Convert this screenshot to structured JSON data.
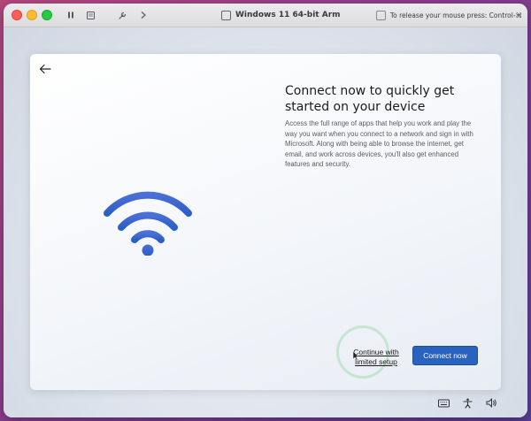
{
  "window": {
    "title": "Windows 11 64-bit Arm",
    "release_hint": "To release your mouse press: Control-⌘"
  },
  "oobe": {
    "heading": "Connect now to quickly get started on your device",
    "description": "Access the full range of apps that help you work and play the way you want when you connect to a network and sign in with Microsoft. Along with being able to browse the internet, get email, and work across devices, you'll also get enhanced features and security.",
    "continue_label": "Continue with limited setup",
    "connect_label": "Connect now"
  },
  "icons": {
    "back": "back-arrow-icon",
    "wifi": "wifi-icon",
    "keyboard": "keyboard-icon",
    "accessibility": "accessibility-icon",
    "volume": "volume-icon"
  },
  "colors": {
    "primary_button": "#2a62bf",
    "wifi_gradient_start": "#4a6fd8",
    "wifi_gradient_end": "#2c5fc4"
  }
}
